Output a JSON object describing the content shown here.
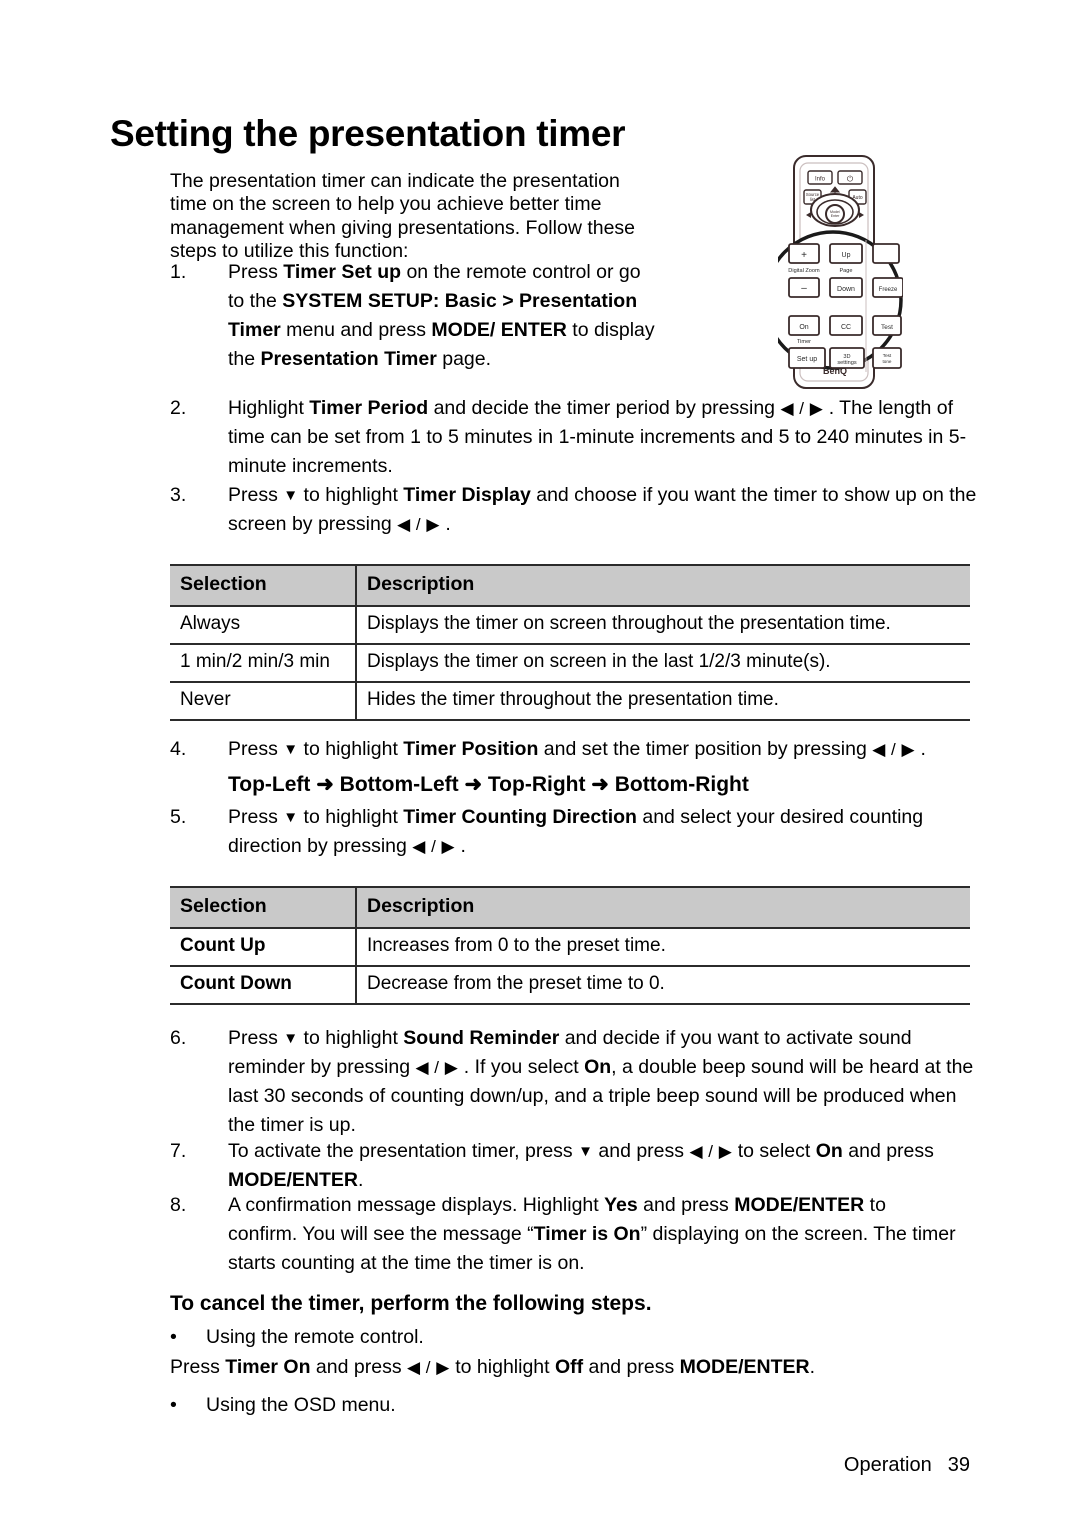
{
  "document": {
    "title": "Setting the presentation timer",
    "intro": "The presentation timer can indicate the presentation time on the screen to help you achieve better time management when giving presentations. Follow these steps to utilize this function:"
  },
  "steps": {
    "s1": {
      "num": "1.",
      "p1": "Press ",
      "b1": "Timer Set up",
      "p2": " on the remote control or go to the ",
      "b2": "SYSTEM SETUP: Basic >",
      "p3": " ",
      "b3": "Presentation Timer",
      "p4": " menu and press ",
      "b4": "MODE/ ENTER",
      "p5": " to display the ",
      "b5": "Presentation Timer",
      "p6": " page."
    },
    "s2": {
      "num": "2.",
      "p1": "Highlight ",
      "b1": "Timer Period",
      "p2": " and decide the timer period by pressing ",
      "arrows": "◀ / ▶",
      "p3": " . The length of time can be set from 1 to 5 minutes in 1-minute increments and 5 to 240 minutes in 5-minute increments."
    },
    "s3": {
      "num": "3.",
      "p1": "Press ",
      "down": "▼",
      "p2": " to highlight ",
      "b1": "Timer Display",
      "p3": " and choose if you want the timer to show up on the screen by pressing ",
      "arrows": "◀ / ▶",
      "p4": " ."
    },
    "s4": {
      "num": "4.",
      "p1": "Press ",
      "down": "▼",
      "p2": " to highlight ",
      "b1": "Timer Position",
      "p3": " and set the timer position by pressing ",
      "arrows": "◀ / ▶",
      "p4": " .",
      "sequence": "Top-Left ➜ Bottom-Left ➜ Top-Right ➜ Bottom-Right"
    },
    "s5": {
      "num": "5.",
      "p1": "Press ",
      "down": "▼",
      "p2": " to highlight ",
      "b1": "Timer Counting Direction",
      "p3": " and select your desired counting direction by pressing ",
      "arrows": "◀ / ▶",
      "p4": " ."
    },
    "s6": {
      "num": "6.",
      "p1": "Press ",
      "down": "▼",
      "p2": " to highlight ",
      "b1": "Sound Reminder",
      "p3": " and decide if you want to activate sound reminder by pressing ",
      "arrows": "◀ / ▶",
      "p4": " . If you select ",
      "b2": "On",
      "p5": ", a double beep sound will be heard at the last 30 seconds of counting down/up, and a triple beep sound will be produced when the timer is up."
    },
    "s7": {
      "num": "7.",
      "p1": "To activate the presentation timer, press ",
      "down": "▼",
      "p2": " and press ",
      "arrows": "◀ / ▶",
      "p3": " to select ",
      "b1": "On",
      "p4": " and press ",
      "b2": "MODE/ENTER",
      "p5": "."
    },
    "s8": {
      "num": "8.",
      "p1": "A confirmation message displays. Highlight ",
      "b1": "Yes",
      "p2": " and press ",
      "b2": "MODE/ENTER",
      "p3": " to confirm. You will see the message “",
      "b3": "Timer is On",
      "p4": "” displaying on the  screen. The timer starts counting at the time the timer is on."
    }
  },
  "table_display": {
    "headers": [
      "Selection",
      "Description"
    ],
    "rows": [
      [
        "Always",
        "Displays the timer on screen throughout the presentation time."
      ],
      [
        "1 min/2 min/3 min",
        "Displays the timer on screen in the last 1/2/3 minute(s)."
      ],
      [
        "Never",
        "Hides the timer throughout the presentation time."
      ]
    ]
  },
  "table_direction": {
    "headers": [
      "Selection",
      "Description"
    ],
    "rows": [
      [
        "Count Up",
        "Increases from 0 to the preset time."
      ],
      [
        "Count Down",
        "Decrease from the preset time to 0."
      ]
    ]
  },
  "cancel": {
    "heading": "To cancel the timer, perform the following steps.",
    "bullet1": "Using the remote control.",
    "line": {
      "p1": "Press ",
      "b1": "Timer On",
      "p2": " and press ",
      "arrows": "◀ / ▶",
      "p3": " to highlight ",
      "b2": "Off",
      "p4": " and press ",
      "b3": "MODE/ENTER",
      "p5": "."
    },
    "bullet2": "Using the OSD menu.",
    "bullet_glyph": "•"
  },
  "footer": {
    "section": "Operation",
    "page": "39"
  },
  "remote": {
    "brand": "BenQ",
    "buttons": {
      "info": "Info",
      "power": "⏻",
      "source": "Source",
      "auto": "Auto",
      "zoom_plus": "+",
      "zoom_minus": "–",
      "digital_zoom_label": "Digital Zoom",
      "page_up": "Up",
      "page_label": "Page",
      "page_down": "Down",
      "freeze": "Freeze",
      "timer_on": "On",
      "cc": "CC",
      "test": "Test",
      "timer_label": "Timer",
      "timer_setup": "Set up",
      "three_d": "3D settings",
      "test_tone": "Test tone"
    }
  }
}
